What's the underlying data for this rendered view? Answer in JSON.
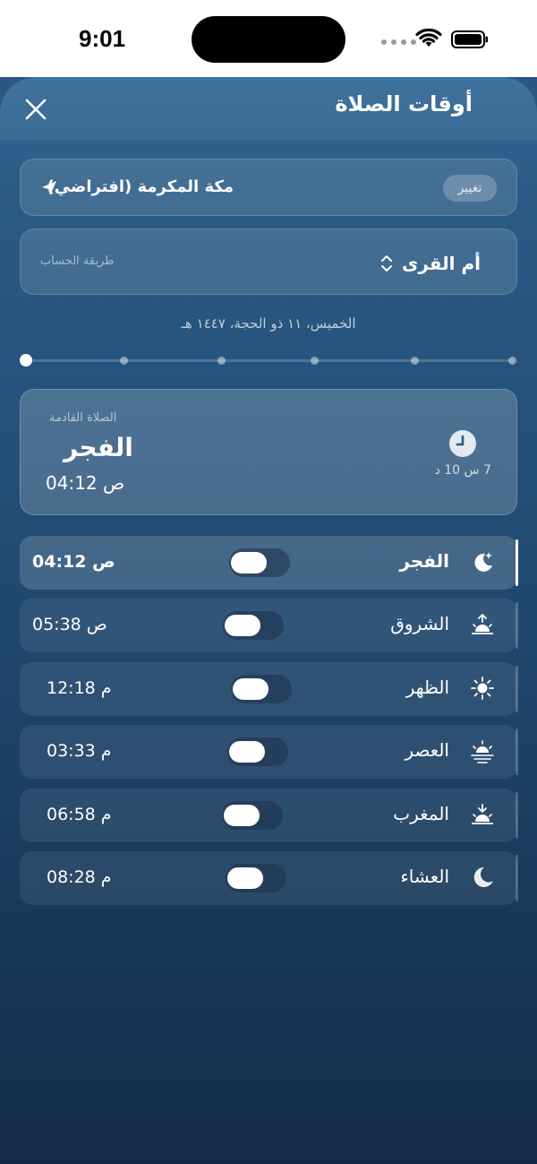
{
  "status_bar": {
    "time": "9:01"
  },
  "header": {
    "title": "أوقات الصلاة"
  },
  "location": {
    "name": "مكة المكرمة (افتراضي)",
    "change_label": "تغيير"
  },
  "method": {
    "label": "طريقة الحساب",
    "value": "أم القرى"
  },
  "date": {
    "text": "الخميس، ١١ ذو الحجة، ١٤٤٧ هـ"
  },
  "day_slider": {
    "count": 6,
    "selected_index": 0
  },
  "next_prayer": {
    "label": "الصلاة القادمة",
    "name": "الفجر",
    "time": "04:12 ص",
    "countdown": "7 س 10 د"
  },
  "prayers": [
    {
      "name": "الفجر",
      "time": "04:12 ص",
      "icon": "crescent-star-icon",
      "current": true
    },
    {
      "name": "الشروق",
      "time": "05:38 ص",
      "icon": "sunrise-icon",
      "current": false
    },
    {
      "name": "الظهر",
      "time": "12:18 م",
      "icon": "sun-icon",
      "current": false
    },
    {
      "name": "العصر",
      "time": "03:33 م",
      "icon": "sun-horizon-icon",
      "current": false
    },
    {
      "name": "المغرب",
      "time": "06:58 م",
      "icon": "sunset-icon",
      "current": false
    },
    {
      "name": "العشاء",
      "time": "08:28 م",
      "icon": "moon-icon",
      "current": false
    }
  ],
  "colors": {
    "accent": "#ffffff",
    "background_top": "#2a5a86",
    "background_bottom": "#142c49"
  }
}
